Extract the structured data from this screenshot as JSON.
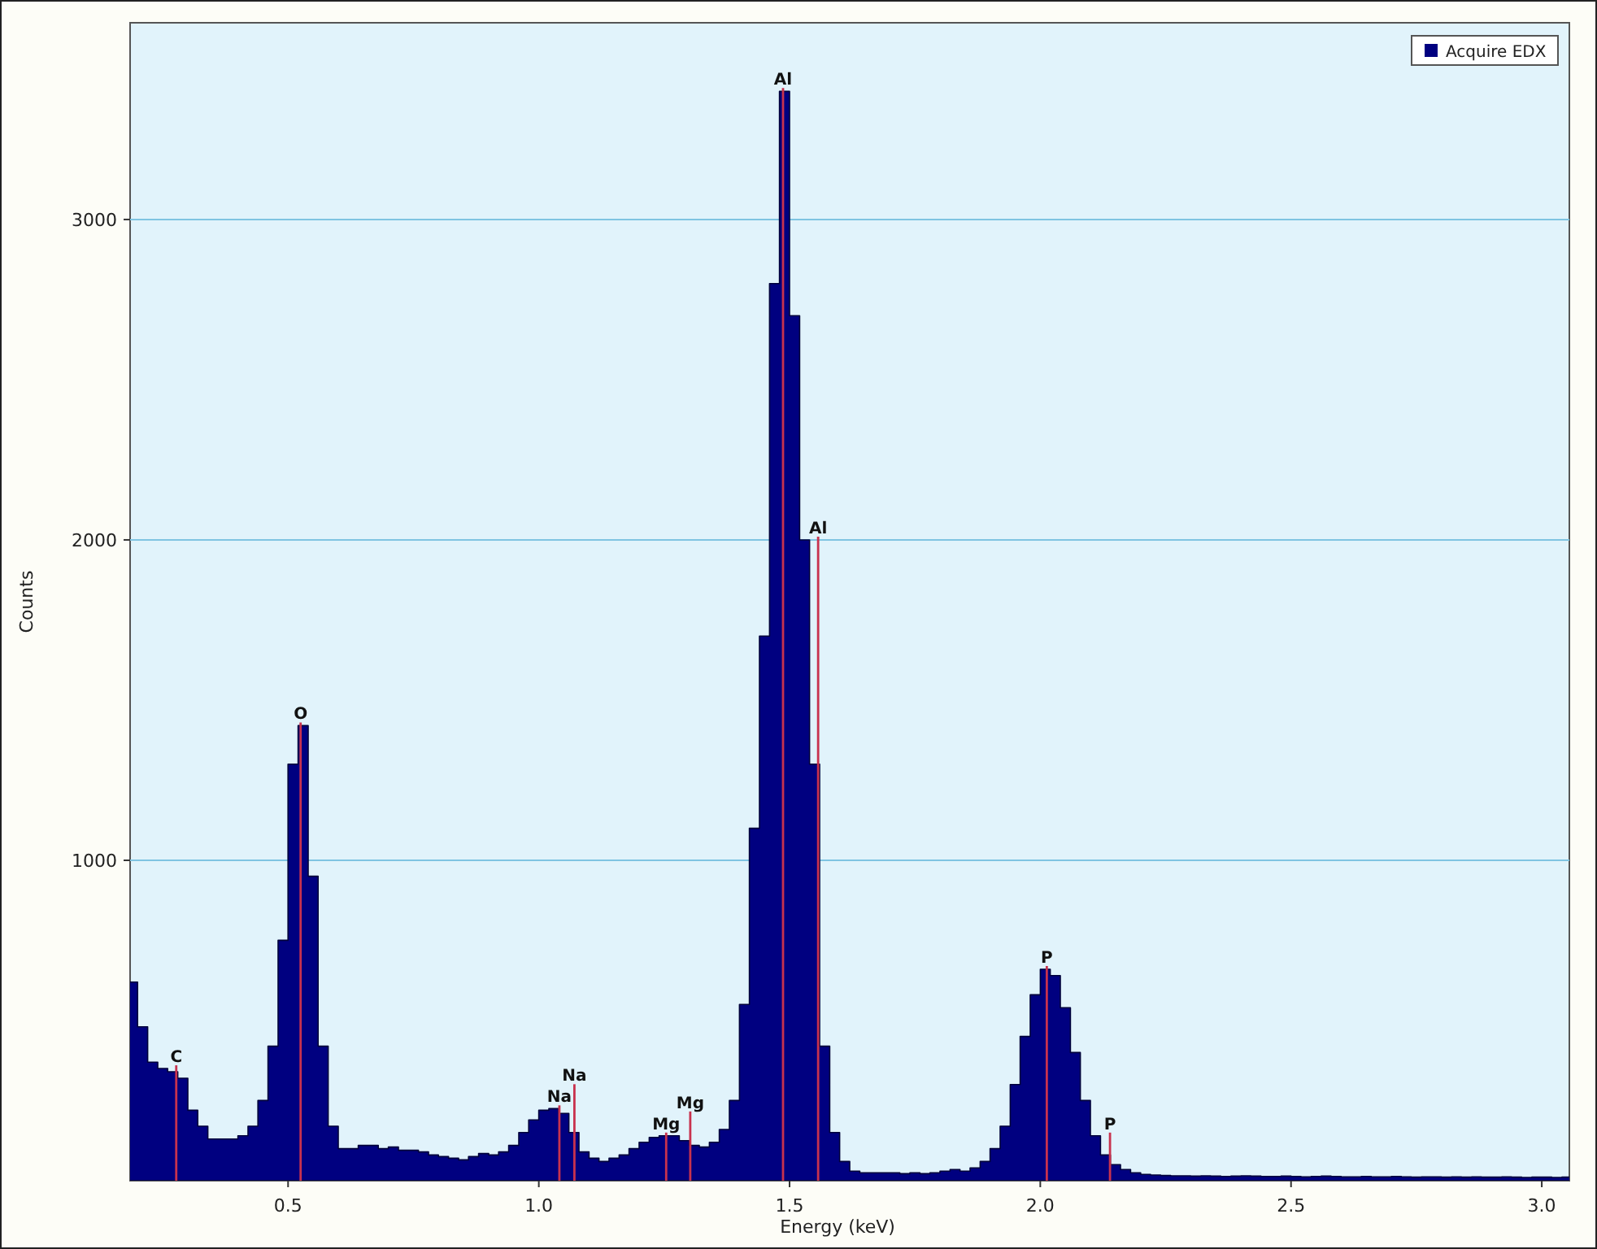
{
  "chart_data": {
    "type": "area",
    "xlabel": "Energy (keV)",
    "ylabel": "Counts",
    "xlim": [
      0.185,
      3.055
    ],
    "ylim": [
      0,
      3614
    ],
    "xticks": [
      {
        "value": 0.5,
        "label": "0.5"
      },
      {
        "value": 1.0,
        "label": "1.0"
      },
      {
        "value": 1.5,
        "label": "1.5"
      },
      {
        "value": 2.0,
        "label": "2.0"
      },
      {
        "value": 2.5,
        "label": "2.5"
      },
      {
        "value": 3.0,
        "label": "3.0"
      }
    ],
    "yticks": [
      1000,
      2000,
      3000
    ],
    "x": [
      0.19,
      0.21,
      0.23,
      0.25,
      0.27,
      0.29,
      0.31,
      0.33,
      0.35,
      0.37,
      0.39,
      0.41,
      0.43,
      0.45,
      0.47,
      0.49,
      0.51,
      0.53,
      0.55,
      0.57,
      0.59,
      0.61,
      0.63,
      0.65,
      0.67,
      0.69,
      0.71,
      0.73,
      0.75,
      0.77,
      0.79,
      0.81,
      0.83,
      0.85,
      0.87,
      0.89,
      0.91,
      0.93,
      0.95,
      0.97,
      0.99,
      1.01,
      1.03,
      1.05,
      1.07,
      1.09,
      1.11,
      1.13,
      1.15,
      1.17,
      1.19,
      1.21,
      1.23,
      1.25,
      1.27,
      1.29,
      1.31,
      1.33,
      1.35,
      1.37,
      1.39,
      1.41,
      1.43,
      1.45,
      1.47,
      1.49,
      1.51,
      1.53,
      1.55,
      1.57,
      1.59,
      1.61,
      1.63,
      1.65,
      1.67,
      1.69,
      1.71,
      1.73,
      1.75,
      1.77,
      1.79,
      1.81,
      1.83,
      1.85,
      1.87,
      1.89,
      1.91,
      1.93,
      1.95,
      1.97,
      1.99,
      2.01,
      2.03,
      2.05,
      2.07,
      2.09,
      2.11,
      2.13,
      2.15,
      2.17,
      2.19,
      2.21,
      2.23,
      2.25,
      2.27,
      2.29,
      2.31,
      2.33,
      2.35,
      2.37,
      2.39,
      2.41,
      2.43,
      2.45,
      2.47,
      2.49,
      2.51,
      2.53,
      2.55,
      2.57,
      2.59,
      2.61,
      2.63,
      2.65,
      2.67,
      2.69,
      2.71,
      2.73,
      2.75,
      2.77,
      2.79,
      2.81,
      2.83,
      2.85,
      2.87,
      2.89,
      2.91,
      2.93,
      2.95,
      2.97,
      2.99,
      3.01,
      3.03,
      3.05
    ],
    "series": [
      {
        "name": "Acquire EDX",
        "color": "#000080",
        "values": [
          620,
          480,
          370,
          350,
          340,
          320,
          220,
          170,
          130,
          130,
          130,
          140,
          170,
          250,
          420,
          750,
          1300,
          1420,
          950,
          420,
          170,
          100,
          100,
          110,
          110,
          100,
          105,
          95,
          95,
          90,
          80,
          75,
          70,
          65,
          75,
          85,
          80,
          90,
          110,
          150,
          190,
          220,
          225,
          210,
          150,
          90,
          70,
          60,
          70,
          80,
          100,
          120,
          135,
          140,
          140,
          125,
          110,
          105,
          120,
          160,
          250,
          550,
          1100,
          1700,
          2800,
          3400,
          2700,
          2000,
          1300,
          420,
          150,
          60,
          30,
          25,
          25,
          25,
          25,
          22,
          25,
          22,
          25,
          30,
          35,
          30,
          40,
          60,
          100,
          170,
          300,
          450,
          580,
          660,
          640,
          540,
          400,
          250,
          140,
          80,
          50,
          35,
          25,
          20,
          18,
          16,
          15,
          15,
          14,
          15,
          14,
          13,
          14,
          15,
          14,
          13,
          13,
          14,
          13,
          12,
          13,
          14,
          13,
          12,
          12,
          13,
          12,
          12,
          13,
          12,
          11,
          12,
          12,
          11,
          12,
          11,
          12,
          11,
          11,
          12,
          11,
          10,
          11,
          11,
          10,
          11
        ]
      }
    ],
    "grid": true,
    "ref_lines": [
      {
        "axis": "x",
        "value": 0.277,
        "label": "C"
      },
      {
        "axis": "x",
        "value": 0.525,
        "label": "O"
      },
      {
        "axis": "x",
        "value": 1.041,
        "label": "Na"
      },
      {
        "axis": "x",
        "value": 1.071,
        "label": "Na"
      },
      {
        "axis": "x",
        "value": 1.254,
        "label": "Mg"
      },
      {
        "axis": "x",
        "value": 1.302,
        "label": "Mg"
      },
      {
        "axis": "x",
        "value": 1.487,
        "label": "Al"
      },
      {
        "axis": "x",
        "value": 1.557,
        "label": "Al"
      },
      {
        "axis": "x",
        "value": 2.013,
        "label": "P"
      },
      {
        "axis": "x",
        "value": 2.139,
        "label": "P"
      }
    ]
  }
}
